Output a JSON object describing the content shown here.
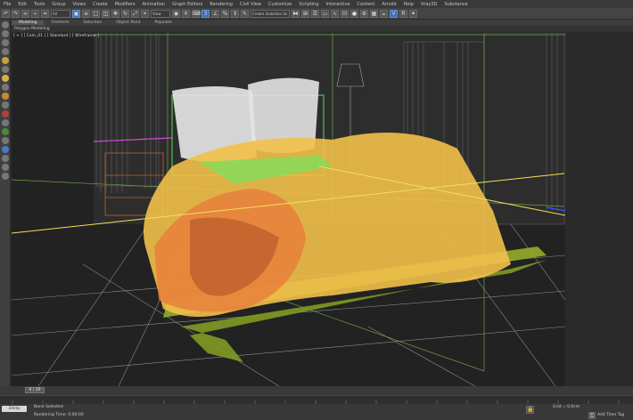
{
  "menu": [
    "File",
    "Edit",
    "Tools",
    "Group",
    "Views",
    "Create",
    "Modifiers",
    "Animation",
    "Graph Editors",
    "Rendering",
    "Civil View",
    "Customize",
    "Scripting",
    "Interactive",
    "Content",
    "Arnold",
    "Help",
    "Vray3D",
    "Substance"
  ],
  "toolbar": {
    "filter": "All",
    "view": "View",
    "selection_set": "Create Selection Se"
  },
  "ribbon": {
    "tabs": [
      "Modeling",
      "Freeform",
      "Selection",
      "Object Paint",
      "Populate"
    ],
    "sub": "Polygon Modeling"
  },
  "viewport": {
    "label": "[ + ] [ Cam_01 ] [ Standard ] [ Wireframe ]"
  },
  "timeline": {
    "frame": "0 / 20",
    "ticks": [
      "0",
      "1",
      "2",
      "3",
      "4",
      "5",
      "6",
      "7",
      "8",
      "9",
      "10",
      "11",
      "12",
      "13",
      "14",
      "15",
      "16",
      "17",
      "18",
      "19",
      "20"
    ]
  },
  "status": {
    "selected": "None Selected",
    "render_time": "Rendering Time: 0:00:00",
    "grid": "Grid = 0,0cm",
    "add_time_tag": "Add Time Tag",
    "logo": "3dsky"
  },
  "colors": {
    "bedspread": "#f2c04a",
    "pillows": "#e8e8e8",
    "floor_lines": "#9a9a9a",
    "rug": "#9ab52a",
    "selection": "#c8d870"
  }
}
